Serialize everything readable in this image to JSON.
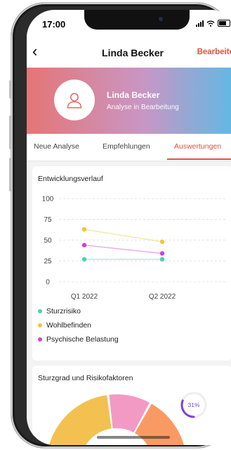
{
  "status": {
    "time": "17:00"
  },
  "nav": {
    "back": "‹",
    "title": "Linda Becker",
    "edit": "Bearbeiten"
  },
  "profile": {
    "name": "Linda Becker",
    "status": "Analyse in Bearbeitung"
  },
  "tabs": [
    {
      "label": "Neue Analyse",
      "active": false
    },
    {
      "label": "Empfehlungen",
      "active": false
    },
    {
      "label": "Auswertungen",
      "active": true
    }
  ],
  "chart_data": [
    {
      "type": "line",
      "title": "Entwicklungsverlauf",
      "categories": [
        "Q1 2022",
        "Q2 2022"
      ],
      "ylim": [
        0,
        100
      ],
      "yticks": [
        100,
        75,
        50,
        25,
        0
      ],
      "grid": true,
      "legend": "bottom",
      "series": [
        {
          "name": "Sturzrisiko",
          "color": "#4fcfb0",
          "values": [
            27,
            27
          ]
        },
        {
          "name": "Wohlbefinden",
          "color": "#f5c437",
          "values": [
            63,
            48
          ]
        },
        {
          "name": "Psychische Belastung",
          "color": "#cc44d6",
          "values": [
            44,
            34
          ]
        }
      ]
    },
    {
      "type": "pie",
      "title": "Sturzgrad und Risikofaktoren",
      "slices": [
        {
          "color": "#f2c14f"
        },
        {
          "color": "#f29ac4"
        },
        {
          "color": "#fa9a63"
        }
      ],
      "gauge": {
        "label": "31%",
        "value": 31,
        "color": "#7a44d6"
      }
    }
  ]
}
